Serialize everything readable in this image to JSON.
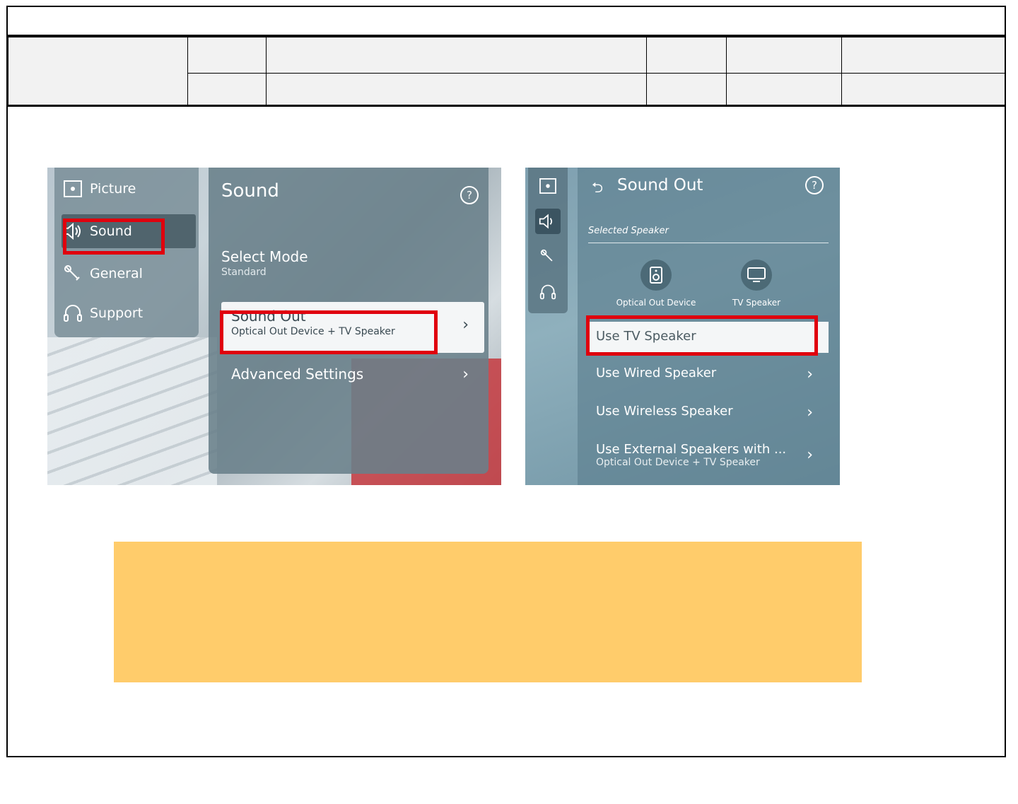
{
  "screens": {
    "left": {
      "side_menu": [
        {
          "label": "Picture",
          "icon": "picture-icon"
        },
        {
          "label": "Sound",
          "icon": "speaker-icon"
        },
        {
          "label": "General",
          "icon": "wrench-icon"
        },
        {
          "label": "Support",
          "icon": "headset-icon"
        }
      ],
      "panel_title": "Sound",
      "help": "?",
      "items": [
        {
          "title": "Select Mode",
          "subtitle": "Standard"
        },
        {
          "title": "Sound Out",
          "subtitle": "Optical Out Device + TV Speaker",
          "chevron": "›"
        },
        {
          "title": "Advanced Settings",
          "chevron": "›"
        }
      ]
    },
    "right": {
      "back": "⮌",
      "panel_title": "Sound Out",
      "help": "?",
      "selected_label": "Selected Speaker",
      "speakers": [
        {
          "label": "Optical Out Device",
          "icon": "optical-speaker-icon"
        },
        {
          "label": "TV Speaker",
          "icon": "tv-icon"
        }
      ],
      "items": [
        {
          "title": "Use TV Speaker"
        },
        {
          "title": "Use Wired Speaker",
          "chevron": "›"
        },
        {
          "title": "Use Wireless Speaker",
          "chevron": "›"
        },
        {
          "title": "Use External Speakers with ...",
          "subtitle": "Optical Out Device + TV Speaker",
          "chevron": "›"
        }
      ]
    }
  },
  "colors": {
    "highlight_box": "#e0000d",
    "note_box": "#ffcc6b"
  }
}
